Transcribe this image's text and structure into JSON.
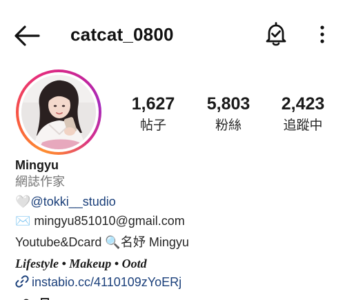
{
  "header": {
    "username": "catcat_0800",
    "back_icon": "arrow-left-icon",
    "notify_icon": "bell-check-icon",
    "more_icon": "more-vertical-icon"
  },
  "avatar": {
    "ring_colors": [
      "#fd8d32",
      "#e62d7b",
      "#a52bbd"
    ]
  },
  "stats": {
    "posts": {
      "value": "1,627",
      "label": "帖子"
    },
    "followers": {
      "value": "5,803",
      "label": "粉絲"
    },
    "following": {
      "value": "2,423",
      "label": "追蹤中"
    }
  },
  "bio": {
    "name": "Mingyu",
    "category": "網誌作家",
    "mention_prefix": "🤍",
    "mention": "@tokki__studio",
    "email_icon": "✉️",
    "email": " mingyu851010@gmail.com",
    "youtube_line": "Youtube&Dcard 🔍名妤 Mingyu",
    "tagline": "Lifestyle • Makeup • Ootd",
    "link_icon": "link-icon",
    "link": "instabio.cc/4110109zYoERj"
  },
  "colors": {
    "link": "#1a3f7a",
    "muted": "#737373",
    "text": "#262626"
  }
}
